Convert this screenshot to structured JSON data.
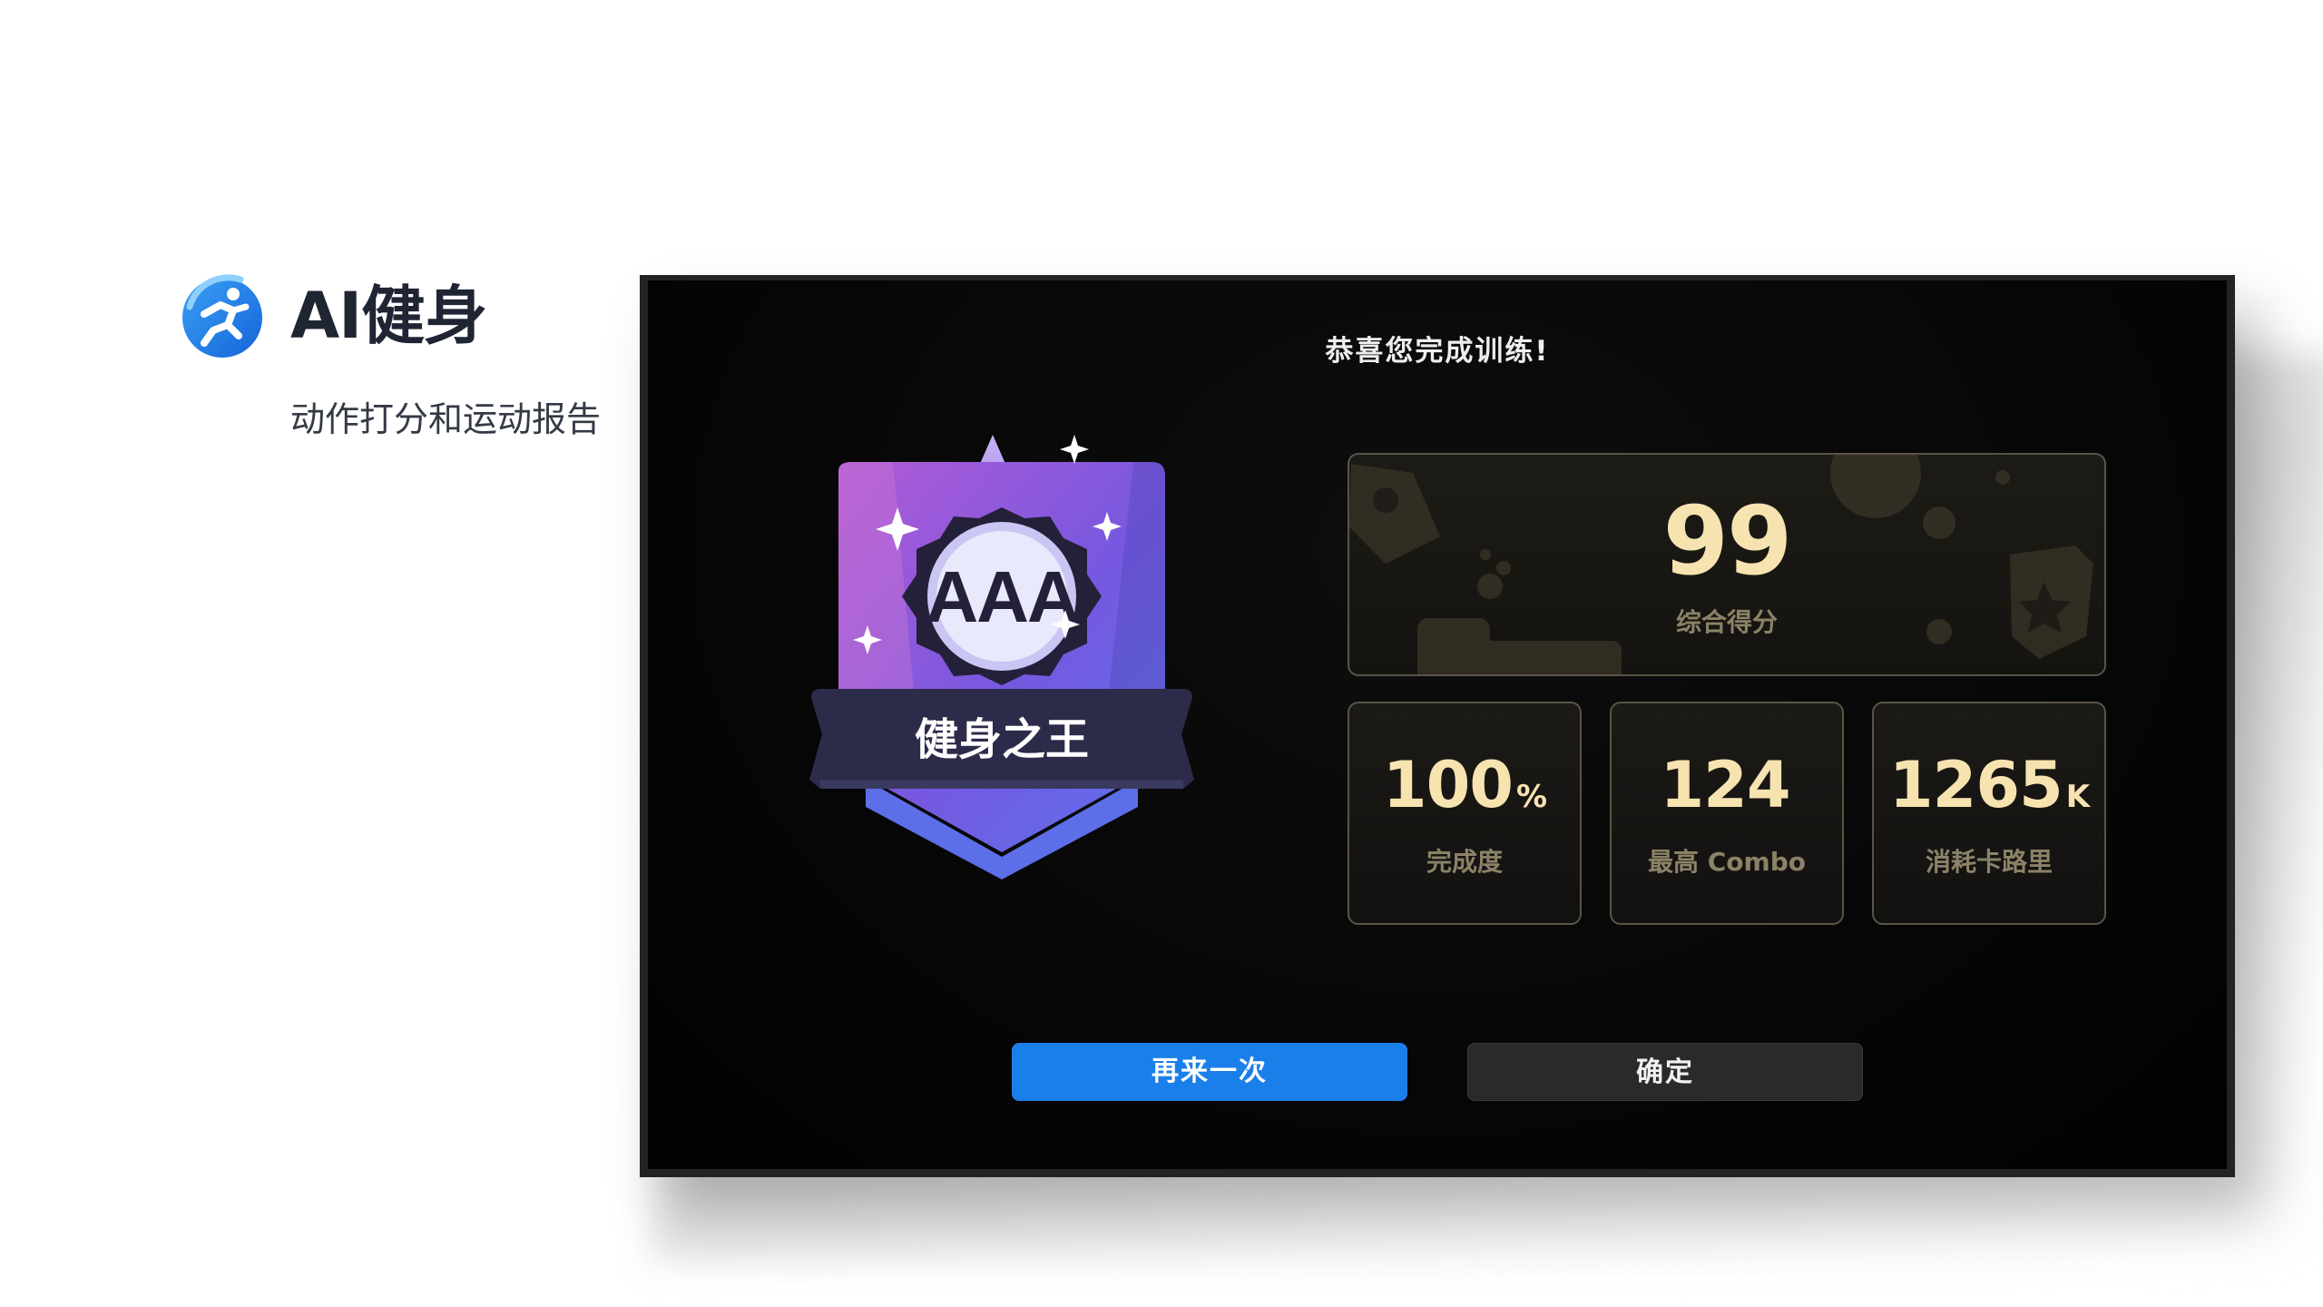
{
  "header": {
    "app_title": "AI健身",
    "app_subtitle": "动作打分和运动报告",
    "logo_icon": "running-person-icon"
  },
  "screen": {
    "congrats_text": "恭喜您完成训练!",
    "badge": {
      "grade": "AAA",
      "title": "健身之王",
      "colors": {
        "shield": "#7b5ce0",
        "ribbon": "#2c2b4a",
        "seal": "#e8e9fb"
      }
    },
    "main_score": {
      "value": "99",
      "label": "综合得分"
    },
    "stats": [
      {
        "value": "100",
        "unit": "%",
        "label": "完成度"
      },
      {
        "value": "124",
        "unit": "",
        "label": "最高 Combo"
      },
      {
        "value": "1265",
        "unit": "K",
        "label": "消耗卡路里"
      }
    ],
    "buttons": {
      "retry": "再来一次",
      "confirm": "确定"
    }
  },
  "colors": {
    "accent_blue": "#1a7fe8",
    "score_gold": "#f7e3b0",
    "label_gold": "#8b8267"
  }
}
